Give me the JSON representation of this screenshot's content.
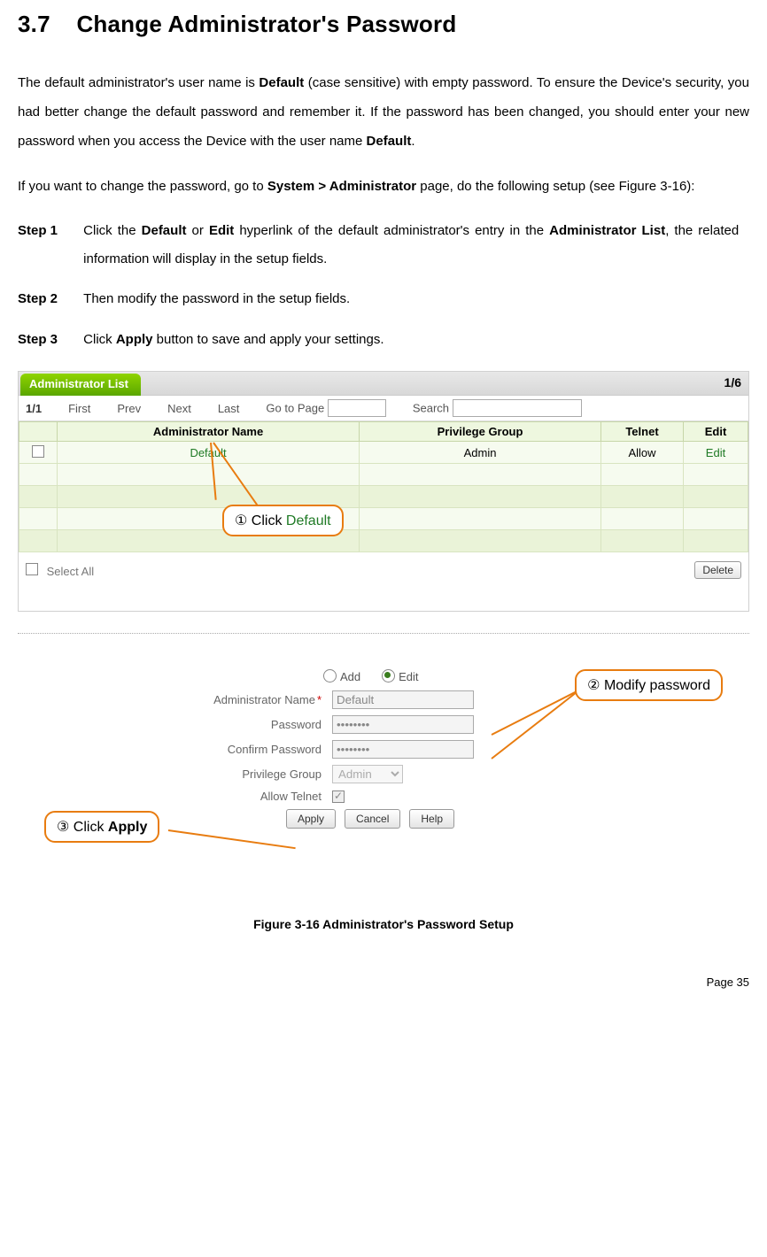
{
  "section": {
    "number": "3.7",
    "title": "Change Administrator's Password"
  },
  "paragraphs": {
    "p1_a": "The default administrator's user name is ",
    "p1_b": "Default",
    "p1_c": " (case sensitive) with empty password. To ensure the Device's security, you had better change the default password and remember it. If the password has been changed, you should enter your new password when you access the Device with the user name ",
    "p1_d": "Default",
    "p1_e": ".",
    "p2_a": "If you want to change the password, go to ",
    "p2_b": "System > Administrator",
    "p2_c": " page, do the following setup (see Figure 3-16):"
  },
  "steps": {
    "s1_label": "Step 1",
    "s1_a": "Click the ",
    "s1_b": "Default",
    "s1_c": " or ",
    "s1_d": "Edit",
    "s1_e": " hyperlink of the default administrator's entry in the ",
    "s1_f": "Administrator List",
    "s1_g": ", the related information will display in the setup fields.",
    "s2_label": "Step 2",
    "s2_text": "Then modify the password in the setup fields.",
    "s3_label": "Step 3",
    "s3_a": "Click ",
    "s3_b": "Apply",
    "s3_c": " button to save and apply your settings."
  },
  "list": {
    "tab": "Administrator List",
    "counter": "1/6",
    "page": "1/1",
    "nav": {
      "first": "First",
      "prev": "Prev",
      "next": "Next",
      "last": "Last"
    },
    "goto_label": "Go to Page",
    "search_label": "Search",
    "headers": {
      "name": "Administrator Name",
      "group": "Privilege Group",
      "telnet": "Telnet",
      "edit": "Edit"
    },
    "row": {
      "name": "Default",
      "group": "Admin",
      "telnet": "Allow",
      "edit": "Edit"
    },
    "select_all": "Select All",
    "delete": "Delete"
  },
  "form": {
    "add": "Add",
    "edit": "Edit",
    "name_label": "Administrator Name",
    "name_value": "Default",
    "pwd_label": "Password",
    "pwd_value": "••••••••",
    "cpwd_label": "Confirm Password",
    "cpwd_value": "••••••••",
    "group_label": "Privilege Group",
    "group_value": "Admin",
    "telnet_label": "Allow Telnet",
    "apply": "Apply",
    "cancel": "Cancel",
    "help": "Help"
  },
  "callouts": {
    "c1_prefix": "① Click ",
    "c1_accent": "Default",
    "c2": "② Modify password",
    "c3_prefix": "③ Click ",
    "c3_bold": "Apply"
  },
  "caption": "Figure 3-16 Administrator's Password Setup",
  "footer": "Page 35"
}
